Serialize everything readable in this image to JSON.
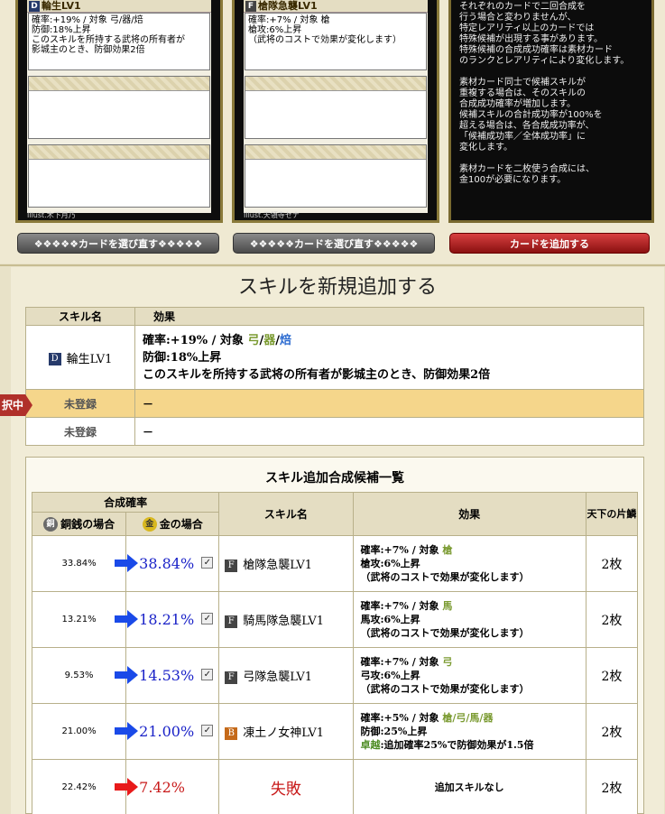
{
  "cards": [
    {
      "grade": "D",
      "grade_color": "#263a6a",
      "title": "輪生LV1",
      "lines": [
        "確率:+19% / 対象 弓/器/焙",
        "防御:18%上昇",
        "このスキルを所持する武将の所有者が",
        "影城主のとき、防御効果2倍"
      ],
      "illust": "Illust.木下月乃"
    },
    {
      "grade": "F",
      "grade_color": "#444444",
      "title": "槍隊急襲LV1",
      "lines": [
        "確率:+7% / 対象 槍",
        "槍攻:6%上昇",
        "（武将のコストで効果が変化します）"
      ],
      "illust": "Illust.天領寺セナ"
    }
  ],
  "note": "それぞれのカードで二回合成を\n行う場合と変わりませんが、\n特定レアリティ以上のカードでは\n特殊候補が出現する事があります。\n特殊候補の合成成功確率は素材カード\nのランクとレアリティにより変化します。\n\n素材カード同士で候補スキルが\n重複する場合は、そのスキルの\n合成成功確率が増加します。\n候補スキルの合計成功率が100%を\n超える場合は、各合成成功率が、\n「候補成功率／全体成功率」に\n変化します。\n\n素材カードを二枚使う合成には、\n金100が必要になります。",
  "buttons": {
    "reselect1": "❖❖❖❖❖カードを選び直す❖❖❖❖❖",
    "reselect2": "❖❖❖❖❖カードを選び直す❖❖❖❖❖",
    "add": "カードを追加する"
  },
  "section": {
    "title": "スキルを新規追加する",
    "skill_table": {
      "col_name": "スキル名",
      "col_effect": "効果",
      "skill1": {
        "grade": "D",
        "name": "輪生LV1",
        "line1_prefix": "確率:+19% / 対象 ",
        "t1": "弓",
        "sep1": "/",
        "t2": "器",
        "sep2": "/",
        "t3": "焙",
        "line2": "防御:18%上昇",
        "line3": "このスキルを所持する武将の所有者が影城主のとき、防御効果2倍"
      },
      "selected_flag": "択中",
      "unreg1": "未登録",
      "unreg1_effect": "－",
      "unreg2": "未登録",
      "unreg2_effect": "－"
    },
    "candidates": {
      "title": "スキル追加合成候補一覧",
      "h_rate": "合成確率",
      "h_copper": "銅銭の場合",
      "h_gold": "金の場合",
      "h_skill": "スキル名",
      "h_effect": "効果",
      "h_count": "天下の片鱗",
      "copper_icon": "銅",
      "gold_icon": "金",
      "rows": [
        {
          "copper": "33.84%",
          "gold": "38.84%",
          "grade": "F",
          "name": "槍隊急襲LV1",
          "l1": "確率:+7% / 対象 ",
          "tag": "槍",
          "l2": "槍攻:6%上昇",
          "l3": "（武将のコストで効果が変化します）",
          "count": "2枚"
        },
        {
          "copper": "13.21%",
          "gold": "18.21%",
          "grade": "F",
          "name": "騎馬隊急襲LV1",
          "l1": "確率:+7% / 対象 ",
          "tag": "馬",
          "l2": "馬攻:6%上昇",
          "l3": "（武将のコストで効果が変化します）",
          "count": "2枚"
        },
        {
          "copper": "9.53%",
          "gold": "14.53%",
          "grade": "F",
          "name": "弓隊急襲LV1",
          "l1": "確率:+7% / 対象 ",
          "tag": "弓",
          "l2": "弓攻:6%上昇",
          "l3": "（武将のコストで効果が変化します）",
          "count": "2枚"
        },
        {
          "copper": "21.00%",
          "gold": "21.00%",
          "grade": "B",
          "name": "凍土ノ女神LV1",
          "l1": "確率:+5% / 対象 ",
          "tag": "槍/弓/馬/器",
          "l2": "防御:25%上昇",
          "l3k": "卓越",
          "l3": ":追加確率25%で防御効果が1.5倍",
          "count": "2枚"
        }
      ],
      "fail": {
        "copper": "22.42%",
        "gold": "7.42%",
        "name": "失敗",
        "effect": "追加スキルなし",
        "count": "2枚"
      }
    }
  }
}
